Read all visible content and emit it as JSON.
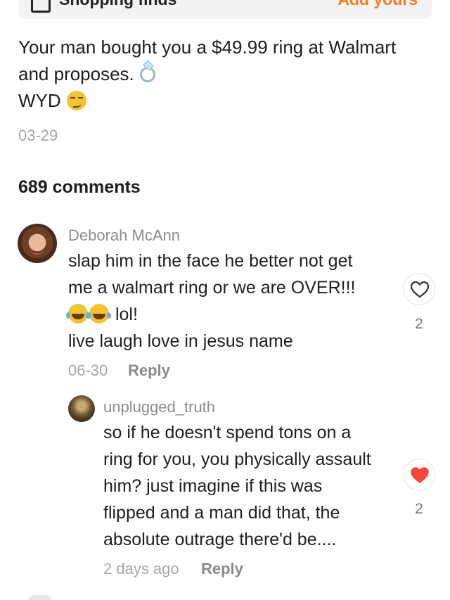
{
  "shopping_bar": {
    "label": "Shopping finds",
    "action": "Add yours",
    "icon": "shopping-bag-icon",
    "action_color": "#ff7a1a"
  },
  "post": {
    "text_lines": [
      "Your man bought you a $49.99 ring at Walmart",
      "and proposes.",
      "WYD"
    ],
    "emojis": [
      "ring-emoji",
      "smirk-emoji"
    ],
    "date": "03-29"
  },
  "comments_header": {
    "count_label": "689 comments"
  },
  "comments": [
    {
      "username": "Deborah McAnn",
      "lines": [
        "slap him in the face he better not get",
        "me a walmart ring or we are OVER!!!",
        "lol!",
        "live laugh love in jesus name"
      ],
      "emojis": [
        "laughing-tears-emoji",
        "laughing-tears-emoji"
      ],
      "date": "06-30",
      "reply_label": "Reply",
      "likes": "2",
      "liked": false
    },
    {
      "username": "unplugged_truth",
      "lines": [
        "so if he doesn't spend tons on a",
        "ring for you, you physically assault",
        "him? just imagine if this was",
        "flipped and a man did that, the",
        "absolute outrage there'd be...."
      ],
      "date": "2 days ago",
      "reply_label": "Reply",
      "likes": "2",
      "liked": true,
      "like_color": "#f2483a"
    }
  ]
}
